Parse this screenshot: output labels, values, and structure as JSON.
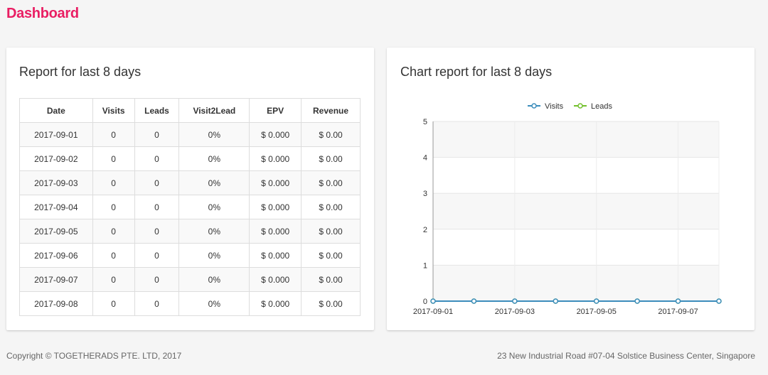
{
  "header": {
    "title": "Dashboard"
  },
  "report": {
    "title": "Report for last 8 days",
    "columns": [
      "Date",
      "Visits",
      "Leads",
      "Visit2Lead",
      "EPV",
      "Revenue"
    ],
    "rows": [
      [
        "2017-09-01",
        "0",
        "0",
        "0%",
        "$ 0.000",
        "$ 0.00"
      ],
      [
        "2017-09-02",
        "0",
        "0",
        "0%",
        "$ 0.000",
        "$ 0.00"
      ],
      [
        "2017-09-03",
        "0",
        "0",
        "0%",
        "$ 0.000",
        "$ 0.00"
      ],
      [
        "2017-09-04",
        "0",
        "0",
        "0%",
        "$ 0.000",
        "$ 0.00"
      ],
      [
        "2017-09-05",
        "0",
        "0",
        "0%",
        "$ 0.000",
        "$ 0.00"
      ],
      [
        "2017-09-06",
        "0",
        "0",
        "0%",
        "$ 0.000",
        "$ 0.00"
      ],
      [
        "2017-09-07",
        "0",
        "0",
        "0%",
        "$ 0.000",
        "$ 0.00"
      ],
      [
        "2017-09-08",
        "0",
        "0",
        "0%",
        "$ 0.000",
        "$ 0.00"
      ]
    ]
  },
  "chart_panel": {
    "title": "Chart report for last 8 days"
  },
  "chart_data": {
    "type": "line",
    "title": "",
    "xlabel": "",
    "ylabel": "",
    "x": [
      "2017-09-01",
      "2017-09-02",
      "2017-09-03",
      "2017-09-04",
      "2017-09-05",
      "2017-09-06",
      "2017-09-07",
      "2017-09-08"
    ],
    "x_tick_labels": [
      "2017-09-01",
      "2017-09-03",
      "2017-09-05",
      "2017-09-07"
    ],
    "ylim": [
      0,
      5
    ],
    "y_ticks": [
      0,
      1,
      2,
      3,
      4,
      5
    ],
    "grid": true,
    "legend": "top-center",
    "series": [
      {
        "name": "Visits",
        "color": "#3c8dbc",
        "values": [
          0,
          0,
          0,
          0,
          0,
          0,
          0,
          0
        ]
      },
      {
        "name": "Leads",
        "color": "#72c02c",
        "values": [
          0,
          0,
          0,
          0,
          0,
          0,
          0,
          0
        ]
      }
    ]
  },
  "footer": {
    "copyright": "Copyright © TOGETHERADS PTE. LTD, 2017",
    "address": "23 New Industrial Road #07-04 Solstice Business Center, Singapore"
  }
}
